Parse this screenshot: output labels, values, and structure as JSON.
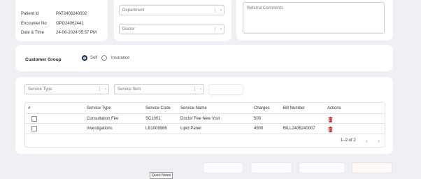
{
  "patient": {
    "id_label": "Patient Id",
    "id_value": "PAT2406240002",
    "encounter_label": "Encounter No",
    "encounter_value": "OPD24062441",
    "datetime_label": "Date & Time",
    "datetime_value": "24-06-2024 05:57 PM"
  },
  "fields": {
    "department_placeholder": "Department",
    "doctor_placeholder": "Doctor",
    "referral_placeholder": "Referral Comments"
  },
  "customer_group": {
    "label": "Customer Group",
    "options": [
      "Self",
      "Insurance"
    ],
    "selected": "Self"
  },
  "service_filters": {
    "service_type_placeholder": "Service Type",
    "service_item_placeholder": "Service Item"
  },
  "table": {
    "headers": [
      "#",
      "Service Type",
      "Service Code",
      "Service Name",
      "Charges",
      "Bill Number",
      "Actions"
    ],
    "rows": [
      {
        "service_type": "Consultation Fee",
        "service_code": "SC1001",
        "service_name": "Doctor Fee New Visit",
        "charges": "500",
        "bill_number": ""
      },
      {
        "service_type": "Investigations",
        "service_code": "LB1008986",
        "service_name": "Lipid Panel",
        "charges": "4500",
        "bill_number": "BILL2406240007"
      }
    ],
    "pagination": "1–2 of 2"
  },
  "footer": {
    "tooltip": "Quick Notes"
  },
  "colors": {
    "accent": "#1f2b57",
    "delete": "#d32f2f"
  },
  "icons": {
    "dropdown": "chevron-right-icon",
    "delete": "trash-icon",
    "prev": "chevron-left-icon",
    "next": "chevron-right-icon"
  }
}
